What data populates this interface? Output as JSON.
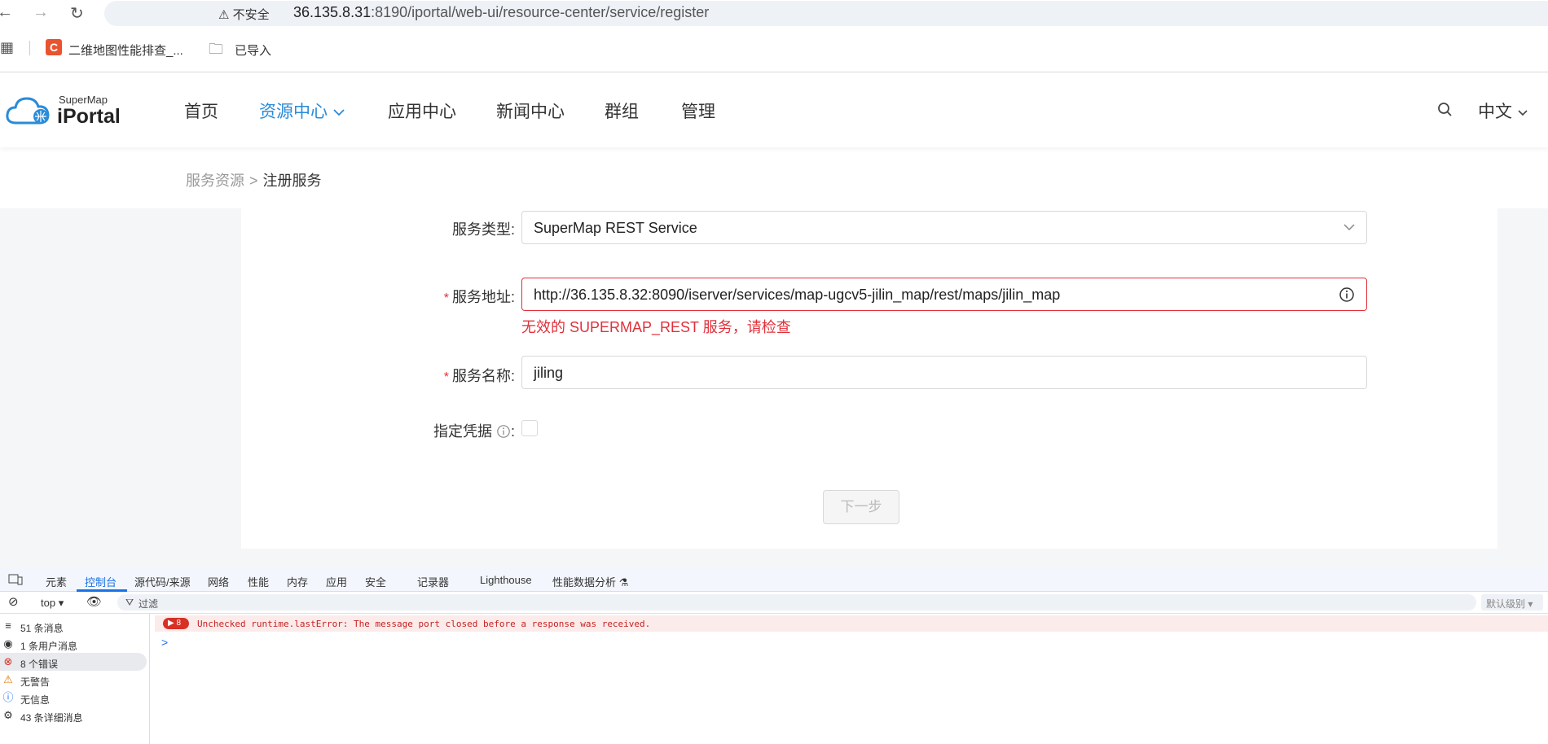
{
  "browser": {
    "security_label": "不安全",
    "url_host": "36.135.8.31",
    "url_rest": ":8190/iportal/web-ui/resource-center/service/register",
    "bookmarks": [
      {
        "label": "二维地图性能排查_..."
      },
      {
        "label": "已导入"
      }
    ]
  },
  "header": {
    "logo_small": "SuperMap",
    "logo_big": "iPortal",
    "nav": [
      "首页",
      "资源中心",
      "应用中心",
      "新闻中心",
      "群组",
      "管理"
    ],
    "active_nav": "资源中心",
    "language": "中文"
  },
  "breadcrumb": {
    "parent": "服务资源",
    "separator": ">",
    "current": "注册服务"
  },
  "form": {
    "service_type_label": "服务类型:",
    "service_type_value": "SuperMap REST Service",
    "service_url_label": "服务地址:",
    "service_url_value": "http://36.135.8.32:8090/iserver/services/map-ugcv5-jilin_map/rest/maps/jilin_map",
    "service_url_error": "无效的 SUPERMAP_REST 服务，请检查",
    "service_name_label": "服务名称:",
    "service_name_value": "jiling",
    "credential_label": "指定凭据",
    "credential_suffix": ":",
    "required_mark": "*",
    "next_button": "下一步"
  },
  "devtools": {
    "tabs": [
      "元素",
      "控制台",
      "源代码/来源",
      "网络",
      "性能",
      "内存",
      "应用",
      "安全",
      "记录器",
      "Lighthouse",
      "性能数据分析"
    ],
    "active_tab": "控制台",
    "context": "top",
    "filter_placeholder": "过滤",
    "level": "默认级别",
    "sidebar": [
      {
        "icon": "≡",
        "label": "51 条消息"
      },
      {
        "icon": "◉",
        "label": "1 条用户消息"
      },
      {
        "icon": "⊗",
        "label": "8 个错误"
      },
      {
        "icon": "⚠",
        "label": "无警告"
      },
      {
        "icon": "ⓘ",
        "label": "无信息"
      },
      {
        "icon": "⚙",
        "label": "43 条详细消息"
      }
    ],
    "error_count": "8",
    "error_message": "Unchecked runtime.lastError: The message port closed before a response was received.",
    "prompt": ">"
  },
  "colors": {
    "accent": "#2a8bd8",
    "error": "#e0303a"
  }
}
